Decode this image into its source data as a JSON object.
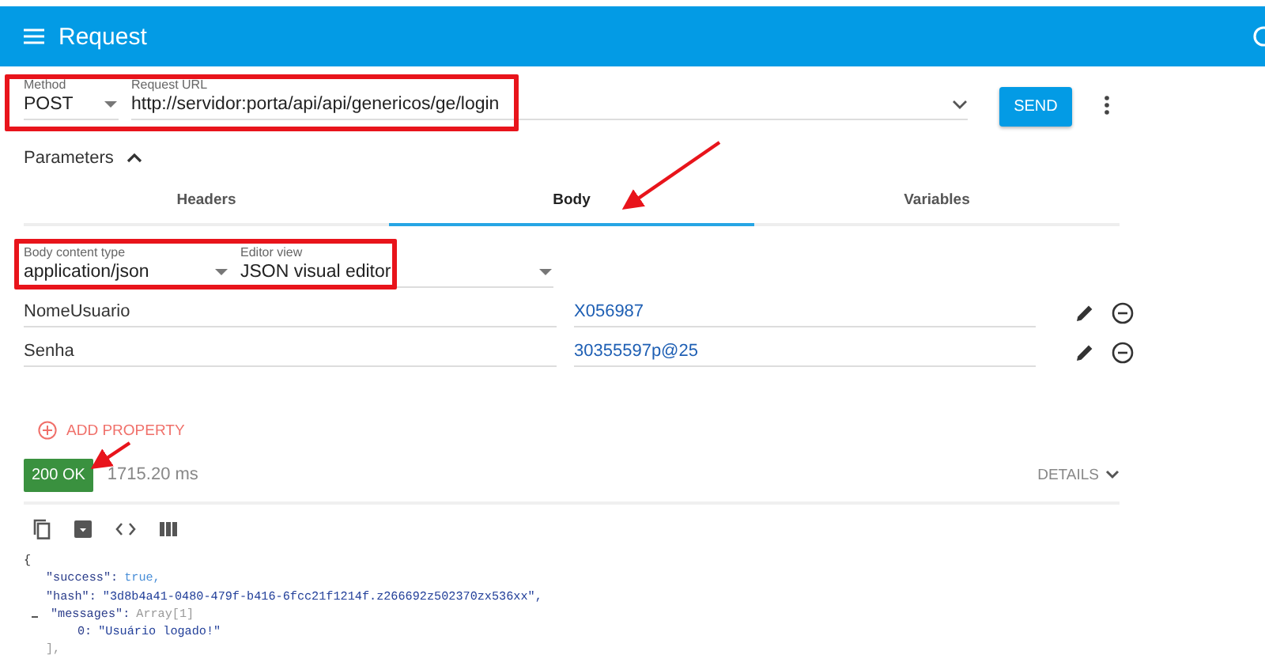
{
  "app_bar": {
    "title": "Request"
  },
  "request": {
    "method_label": "Method",
    "method": "POST",
    "url_label": "Request URL",
    "url": "http://servidor:porta/api/api/genericos/ge/login",
    "send": "SEND"
  },
  "parameters": {
    "label": "Parameters",
    "expanded": true
  },
  "tabs": [
    {
      "label": "Headers",
      "selected": false
    },
    {
      "label": "Body",
      "selected": true
    },
    {
      "label": "Variables",
      "selected": false
    }
  ],
  "body": {
    "content_type_label": "Body content type",
    "content_type": "application/json",
    "editor_label": "Editor view",
    "editor": "JSON visual editor",
    "properties": [
      {
        "name": "NomeUsuario",
        "value": "X056987"
      },
      {
        "name": "Senha",
        "value": "30355597p@25"
      }
    ],
    "add_property": "ADD PROPERTY"
  },
  "response": {
    "status": "200 OK",
    "time": "1715.20 ms",
    "details": "DETAILS",
    "open": "{",
    "entries": [
      {
        "key": "\"success\":",
        "value": "true,",
        "kind": "bool"
      },
      {
        "key": "\"hash\":",
        "value": "\"3d8b4a41-0480-479f-b416-6fcc21f1214f.z266692z502370zx536xx\",",
        "kind": "string"
      },
      {
        "key": "\"messages\":",
        "hint": "Array[1]",
        "expanded": true,
        "close": "],",
        "children": [
          {
            "key": "0:",
            "value": "\"Usuário logado!\"",
            "kind": "string"
          }
        ]
      }
    ]
  }
}
